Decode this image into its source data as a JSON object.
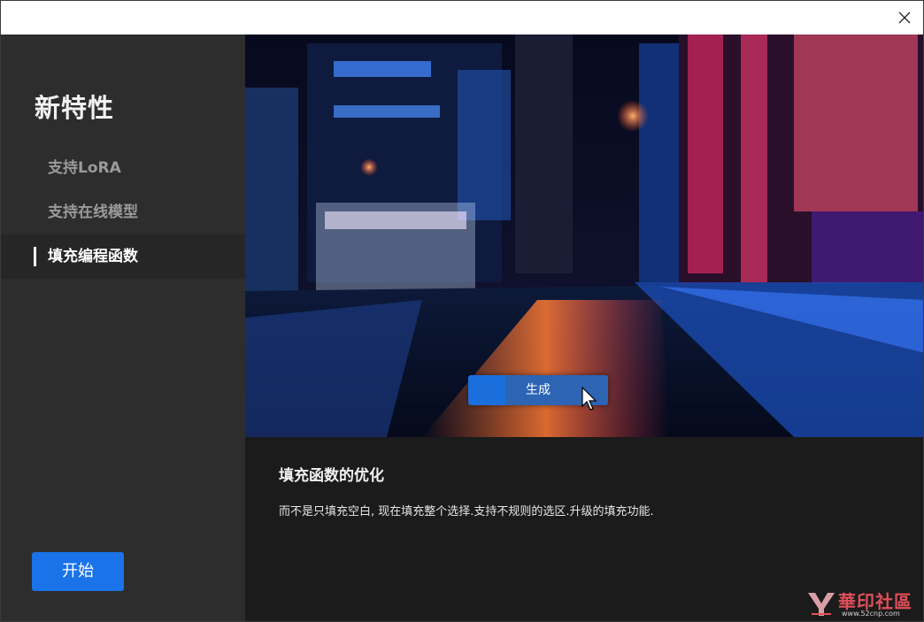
{
  "window": {
    "close_icon": "close-icon"
  },
  "sidebar": {
    "title": "新特性",
    "items": [
      {
        "label": "支持LoRA",
        "active": false
      },
      {
        "label": "支持在线模型",
        "active": false
      },
      {
        "label": "填充编程函数",
        "active": true
      }
    ],
    "start_button": "开始"
  },
  "hero": {
    "generate_button": "生成",
    "cursor_icon": "mouse-pointer-icon"
  },
  "feature": {
    "title": "填充函数的优化",
    "description": "而不是只填充空白, 现在填充整个选择.支持不规则的选区.升级的填充功能."
  },
  "watermark": {
    "text": "華印社區",
    "url": "www.52cnp.com"
  },
  "colors": {
    "accent": "#1a73e8",
    "sidebar_bg": "#2d2d2d",
    "content_bg": "#1b1b1b"
  }
}
